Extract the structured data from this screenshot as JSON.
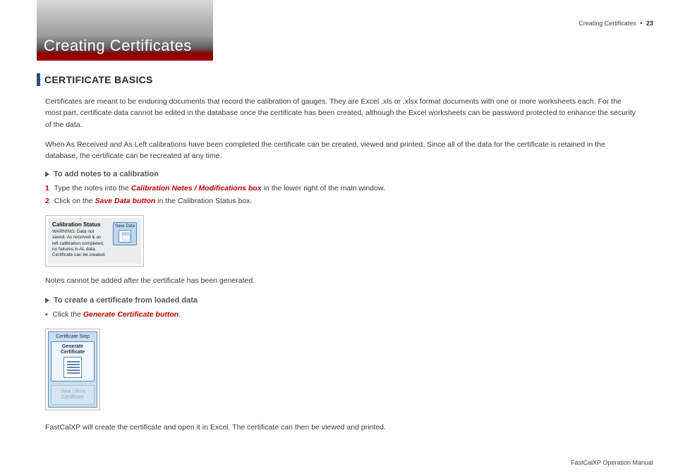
{
  "running_head": {
    "section": "Creating Certificates",
    "page": "23"
  },
  "tab_title": "Creating Certificates",
  "section_title": "CERTIFICATE BASICS",
  "para1": "Certificates are meant to be enduring documents that record the calibration of gauges. They are Excel .xls or .xlsx format documents with one or more worksheets each. For the most part, certificate data cannot be edited in the database once the certificate has been created, although the Excel worksheets can be password protected to enhance the security of the data.",
  "para2": "When As Received and As Left calibrations have been completed the certificate can be created, viewed and printed. Since all of the data for the certificate is retained in the database, the certificate can be recreated at any time.",
  "sub1": "To add notes to a calibration",
  "step1": {
    "num": "1",
    "lead": "Type the notes into the ",
    "link": "Calibration Notes / Modifications box",
    "tail": " in the lower right of the main window."
  },
  "step2": {
    "num": "2",
    "lead": "Click on the ",
    "link": "Save Data button",
    "tail": " in the Calibration Status box."
  },
  "cal_status": {
    "title": "Calibration Status",
    "body": "WARNING: Data not saved. As received & as left calibration completed, no failures in AL data. Certificate can be created.",
    "save_label": "Save Data"
  },
  "note1": "Notes cannot be added after the certificate has been generated.",
  "sub2": "To create a certificate from loaded data",
  "step3": {
    "lead": "Click the ",
    "link": "Generate Certificate button",
    "tail": "."
  },
  "cert_step": {
    "header": "Certificate Step",
    "gen_line1": "Generate",
    "gen_line2": "Certificate",
    "view_line1": "View / Print",
    "view_line2": "Certificate"
  },
  "para3": "FastCalXP will create the certificate and open it in Excel. The certificate can then be viewed and printed.",
  "footer": "FastCalXP Operation Manual"
}
